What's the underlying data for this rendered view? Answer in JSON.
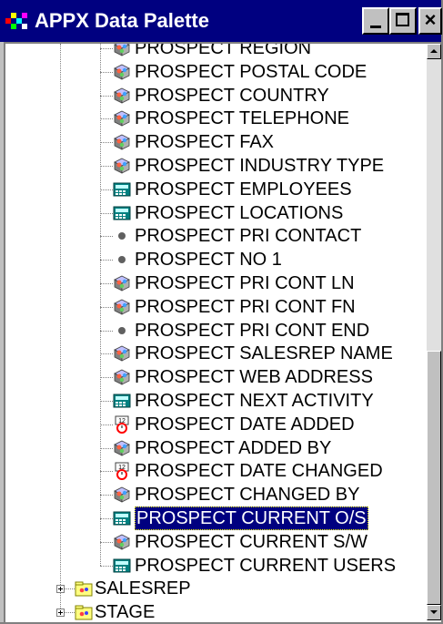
{
  "window": {
    "title": "APPX Data Palette",
    "minimize_label": "",
    "maximize_label": "",
    "close_label": "×"
  },
  "tree": {
    "fields": [
      {
        "label": "PROSPECT REGION",
        "icon": "field-cube-icon"
      },
      {
        "label": "PROSPECT POSTAL CODE",
        "icon": "field-cube-icon"
      },
      {
        "label": "PROSPECT COUNTRY",
        "icon": "field-cube-icon"
      },
      {
        "label": "PROSPECT TELEPHONE",
        "icon": "field-cube-icon"
      },
      {
        "label": "PROSPECT FAX",
        "icon": "field-cube-icon"
      },
      {
        "label": "PROSPECT INDUSTRY TYPE",
        "icon": "field-cube-icon"
      },
      {
        "label": "PROSPECT EMPLOYEES",
        "icon": "numeric-field-icon"
      },
      {
        "label": "PROSPECT LOCATIONS",
        "icon": "numeric-field-icon"
      },
      {
        "label": "PROSPECT PRI CONTACT",
        "icon": "group-dot-icon"
      },
      {
        "label": "PROSPECT NO 1",
        "icon": "group-dot-icon"
      },
      {
        "label": "PROSPECT PRI CONT LN",
        "icon": "field-cube-icon"
      },
      {
        "label": "PROSPECT PRI CONT FN",
        "icon": "field-cube-icon"
      },
      {
        "label": "PROSPECT PRI CONT END",
        "icon": "group-dot-icon"
      },
      {
        "label": "PROSPECT SALESREP NAME",
        "icon": "field-cube-icon"
      },
      {
        "label": "PROSPECT WEB ADDRESS",
        "icon": "field-cube-icon"
      },
      {
        "label": "PROSPECT NEXT ACTIVITY",
        "icon": "numeric-field-icon"
      },
      {
        "label": "PROSPECT DATE ADDED",
        "icon": "date-field-icon"
      },
      {
        "label": "PROSPECT ADDED BY",
        "icon": "field-cube-icon"
      },
      {
        "label": "PROSPECT DATE CHANGED",
        "icon": "date-field-icon"
      },
      {
        "label": "PROSPECT CHANGED BY",
        "icon": "field-cube-icon"
      },
      {
        "label": "PROSPECT CURRENT O/S",
        "icon": "numeric-field-icon"
      },
      {
        "label": "PROSPECT CURRENT S/W",
        "icon": "field-cube-icon"
      },
      {
        "label": "PROSPECT CURRENT USERS",
        "icon": "numeric-field-icon"
      }
    ],
    "selected_index": 20,
    "files": [
      {
        "label": "SALESREP",
        "icon": "file-folder-icon"
      },
      {
        "label": "STAGE",
        "icon": "file-folder-icon"
      }
    ]
  },
  "colors": {
    "titlebar": "#000080",
    "selection": "#000080",
    "window_face": "#c0c0c0"
  }
}
